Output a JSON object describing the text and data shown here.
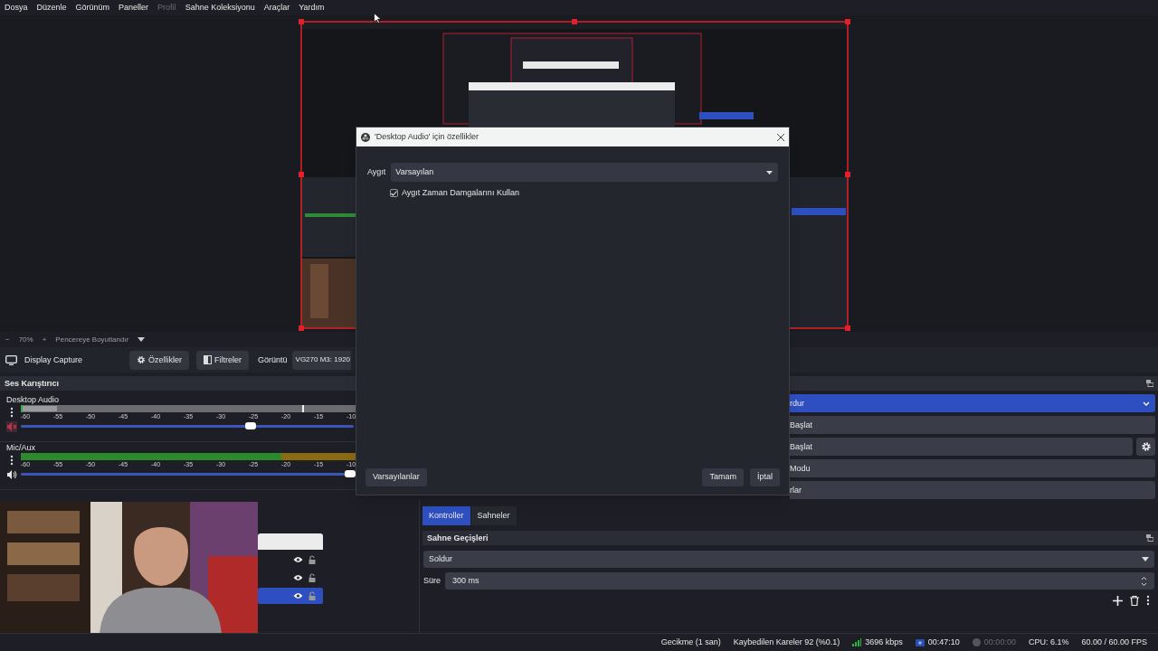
{
  "menu": [
    {
      "label": "Dosya",
      "disabled": false
    },
    {
      "label": "Düzenle",
      "disabled": false
    },
    {
      "label": "Görünüm",
      "disabled": false
    },
    {
      "label": "Paneller",
      "disabled": false
    },
    {
      "label": "Profil",
      "disabled": true
    },
    {
      "label": "Sahne Koleksiyonu",
      "disabled": false
    },
    {
      "label": "Araçlar",
      "disabled": false
    },
    {
      "label": "Yardım",
      "disabled": false
    }
  ],
  "preview_toolbar": {
    "zoom_out": "−",
    "zoom": "70%",
    "zoom_in": "+",
    "fit": "Pencereye Boyutlandır"
  },
  "source_toolbar": {
    "source": "Display Capture",
    "buttons": [
      {
        "kind": "settings",
        "label": "Özellikler"
      },
      {
        "kind": "filters",
        "label": "Filtreler"
      }
    ],
    "display_label": "Görüntü",
    "display_value": "VG270 M3: 1920"
  },
  "mixer": {
    "title": "Ses Karıştırıcı",
    "channels": [
      {
        "name": "Desktop Audio",
        "muted": true,
        "level": 0.69,
        "scale": [
          "-60",
          "-55",
          "-50",
          "-45",
          "-40",
          "-35",
          "-30",
          "-25",
          "-20",
          "-15",
          "-10"
        ]
      },
      {
        "name": "Mic/Aux",
        "muted": false,
        "level": 0.99,
        "scale": [
          "-60",
          "-55",
          "-50",
          "-45",
          "-40",
          "-35",
          "-30",
          "-25",
          "-20",
          "-15",
          "-10"
        ]
      }
    ]
  },
  "sources": [
    {
      "selected": false,
      "visible": true,
      "locked": false
    },
    {
      "selected": false,
      "visible": true,
      "locked": false
    },
    {
      "selected": true,
      "visible": true,
      "locked": false
    }
  ],
  "controls": [
    {
      "kind": "dropdown",
      "label": "rdur",
      "selected": true
    },
    {
      "kind": "button",
      "label": "Başlat",
      "selected": false
    },
    {
      "kind": "settings",
      "label": "Başlat",
      "selected": false
    },
    {
      "kind": "button",
      "label": "Modu",
      "selected": false
    },
    {
      "kind": "button",
      "label": "rlar",
      "selected": false
    }
  ],
  "dock_tabs": [
    {
      "label": "Kontroller",
      "selected": true
    },
    {
      "label": "Sahneler",
      "selected": false
    }
  ],
  "transitions": {
    "title": "Sahne Geçişleri",
    "transition": "Soldur",
    "duration_label": "Süre",
    "duration": "300 ms"
  },
  "status_bar": {
    "delay": "Gecikme (1 san)",
    "dropped": "Kaybedilen Kareler 92 (%0.1)",
    "bitrate": "3696 kbps",
    "stream": {
      "time": "00:47:10",
      "active": true
    },
    "record": {
      "time": "00:00:00",
      "active": false
    },
    "cpu": "CPU: 6.1%",
    "fps": "60.00 / 60.00 FPS"
  },
  "dialog": {
    "title": "'Desktop Audio' için özellikler",
    "device_label": "Aygıt",
    "device": "Varsayılan",
    "checkbox": {
      "label": "Aygıt Zaman Damgalarını Kullan",
      "checked": true
    },
    "buttons": [
      "Varsayılanlar",
      "Tamam",
      "İptal"
    ]
  }
}
